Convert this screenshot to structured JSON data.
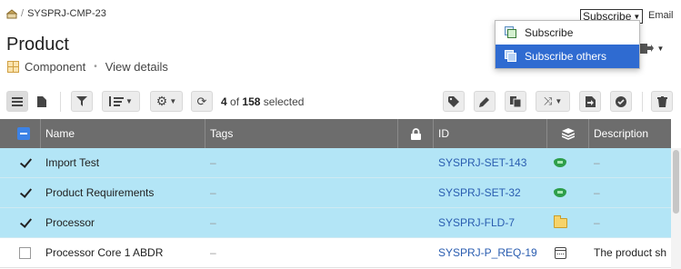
{
  "breadcrumb": {
    "separator": "/",
    "item": "SYSPRJ-CMP-23"
  },
  "page": {
    "title": "Product",
    "type_label": "Component",
    "separator": "•",
    "view_details": "View details"
  },
  "header_actions": {
    "subscribe_value": "Subscribe",
    "email_label": "Email"
  },
  "subscribe_menu": {
    "options": [
      "Subscribe",
      "Subscribe others"
    ],
    "highlighted_index": 1
  },
  "toolbar": {
    "selected_count": "4",
    "of_text": "of",
    "total": "158",
    "selected_text": "selected"
  },
  "table": {
    "columns": [
      "Name",
      "Tags",
      "",
      "ID",
      "",
      "Description"
    ],
    "rows": [
      {
        "checked": true,
        "name": "Import Test",
        "tags": "–",
        "id": "SYSPRJ-SET-143",
        "type_icon": "set-icon",
        "description": "–"
      },
      {
        "checked": true,
        "name": "Product Requirements",
        "tags": "–",
        "id": "SYSPRJ-SET-32",
        "type_icon": "set-icon",
        "description": "–"
      },
      {
        "checked": true,
        "name": "Processor",
        "tags": "–",
        "id": "SYSPRJ-FLD-7",
        "type_icon": "folder-icon",
        "description": "–"
      },
      {
        "checked": false,
        "name": "Processor Core 1 ABDR",
        "tags": "–",
        "id": "SYSPRJ-P_REQ-19",
        "type_icon": "requirement-icon",
        "description": "The product sh"
      }
    ]
  },
  "colors": {
    "selection": "#b3e5f6",
    "header": "#6d6d6d",
    "accent": "#2f6bd1",
    "link": "#2a5db0"
  }
}
